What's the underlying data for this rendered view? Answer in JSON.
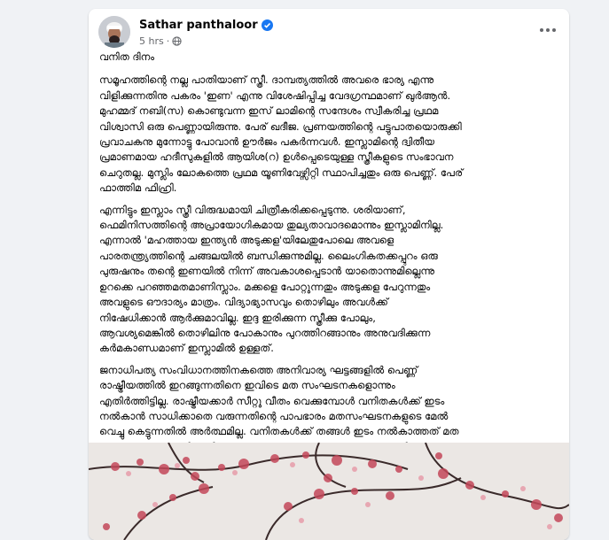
{
  "post": {
    "author_name": "Sathar panthaloor",
    "timestamp": "5 hrs",
    "verified_icon": "verified-badge-icon",
    "audience_icon": "globe-icon",
    "accent_color": "#1877f2",
    "title": "വനിത ദിനം",
    "paragraphs": [
      "സമൂഹത്തിന്റെ നല്ല പാതിയാണ് സ്ത്രീ. ദാമ്പത്യത്തിൽ അവരെ ഭാര്യ എന്നു\nവിളിക്കുന്നതിനു പകരം 'ഇണ' എന്നു വിശേഷിപ്പിച്ച വേദഗ്രന്ഥമാണ് ഖുർആൻ.\nമുഹമ്മദ് നബി(സ) കൊണ്ടുവന്ന ഇസ് ലാമിന്റെ സന്ദേശം സ്വീകരിച്ച പ്രഥമ\nവിശ്വാസി ഒരു പെണ്ണായിരുന്നു. പേര് ഖദീജ. പ്രണയത്തിന്റെ പട്ടുപാതയൊരുക്കി\nപ്രവാചകനു മുന്നോട്ടു പോവാൻ ഊർജം പകർന്നവൾ. ഇസ്ലാമിന്റെ ദ്വിതീയ\nപ്രമാണമായ ഹദീസുകളിൽ ആയിശ(റ) ഉൾപ്പെടെയുള്ള സ്ത്രീകളുടെ സംഭാവന\nചെറുതല്ല. മുസ്ലിം ലോകത്തെ പ്രഥമ യൂണിവേഴ്സിറ്റി സ്ഥാപിച്ചതും ഒരു പെണ്ണ്. പേര്\nഫാത്തിമ ഫിഹ്രി.",
      "എന്നിട്ടും ഇസ്ലാം സ്ത്രീ വിരുദ്ധമായി ചിത്രീകരിക്കപ്പെടുന്നു. ശരിയാണ്,\nഫെമിനിസത്തിന്റെ അപ്രായോഗികമായ തുല്യതാവാദമൊന്നും ഇസ്ലാമിനില്ല.\nഎന്നാൽ 'മഹത്തായ ഇന്ത്യൻ അടുക്കള'യിലേതുപോലെ അവളെ\nപാരതന്ത്ര്യത്തിന്റെ ചങ്ങലയിൽ ബന്ധിക്കുന്നുമില്ല. ലൈംഗികതക്കപ്പുറം ഒരു\nപുരുഷനും തന്റെ ഇണയിൽ നിന്ന് അവകാശപ്പെടാൻ യാതൊന്നുമില്ലെന്നു\nഉറക്കെ പറഞ്ഞമതമാണിസ്ലാം. മക്കളെ പോറ്റുന്നതും അടുക്കള പേറുന്നതും\nഅവളുടെ ഔദാര്യം മാത്രം. വിദ്യാഭ്യാസവും തൊഴിലും അവൾക്ക്\nനിഷേധിക്കാൻ ആർക്കുമാവില്ല. ഇദ്ദ ഇരിക്കുന്ന സ്ത്രീക്കു പോലും,\nആവശ്യമെങ്കിൽ തൊഴിലിനു പോകാനും പുറത്തിറങ്ങാനും അനുവദിക്കുന്ന\nകർമകാണ്ഡമാണ് ഇസ്ലാമിൽ ഉള്ളത്.",
      "ജനാധിപത്യ സംവിധാനത്തിനകത്തെ അനിവാര്യ ഘട്ടങ്ങളിൽ പെണ്ണ്\nരാഷ്ട്രീയത്തിൽ ഇറങ്ങുന്നതിനെ ഇവിടെ മത സംഘടനകളൊന്നും\nഎതിർത്തിട്ടില്ല. രാഷ്ട്രീയക്കാർ സീറ്റു വീതം വെക്കുമ്പോൾ വനിതകൾക്ക് ഇടം\nനൽകാൻ സാധിക്കാതെ വരുന്നതിന്റെ പാപഭാരം മതസംഘടനകളുടെ മേൽ\nവെച്ചു കെട്ടുന്നതിൽ അർത്ഥമില്ല. വനിതകൾക്ക് തങ്ങൾ ഇടം നൽകാത്തത് മത\nസംഘടനകളെ പരിഗണിച്ചു കൊണ്ട് മാത്രമാണെന്നത് ഒരുതരം ഒളിച്ചോട്ടമാണ്.\nസ്ഥലകാല സാഹചര്യങ്ങളെ കണ്ടറിയാൻ കഴിവുള്ളവരാണ് മതനേതൃത്വം."
    ],
    "more_options_icon": "more-options-icon",
    "photo_subject": "pink-blossom-branches-photo"
  }
}
